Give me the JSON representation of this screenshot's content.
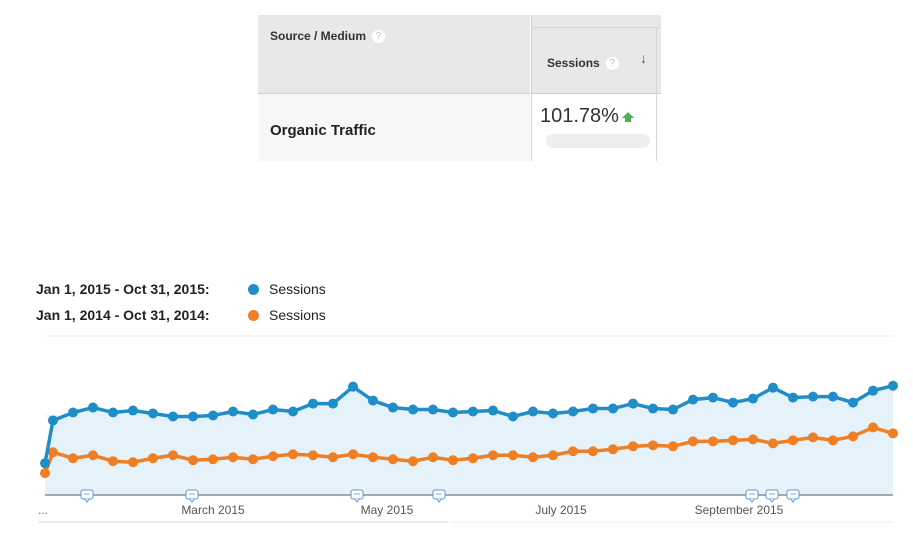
{
  "table": {
    "col1_header": "Source / Medium",
    "col2_header": "Sessions",
    "help_icon": "?",
    "sort_icon": "arrow-down-icon",
    "row_label": "Organic Traffic",
    "row_value": "101.78%",
    "trend_icon": "arrow-up-icon",
    "trend_color": "#4caf50"
  },
  "legend": [
    {
      "range": "Jan 1, 2015 - Oct 31, 2015:",
      "metric": "Sessions",
      "color": "#1f8dc8"
    },
    {
      "range": "Jan 1, 2014 - Oct 31, 2014:",
      "metric": "Sessions",
      "color": "#ef7f22"
    }
  ],
  "chart_data": {
    "type": "line",
    "grid": true,
    "ylim": [
      0,
      160
    ],
    "x_tick_labels": [
      "...",
      "March 2015",
      "May 2015",
      "July 2015",
      "September 2015"
    ],
    "annotation_icon": "comment-icon",
    "annotation_count": 7,
    "series": [
      {
        "color": "#1f8dc8",
        "values": [
          32,
          75,
          83,
          88,
          83,
          85,
          82,
          79,
          79,
          80,
          84,
          81,
          86,
          84,
          92,
          92,
          109,
          95,
          88,
          86,
          86,
          83,
          84,
          85,
          79,
          84,
          82,
          84,
          87,
          87,
          92,
          87,
          86,
          96,
          98,
          93,
          97,
          108,
          98,
          99,
          99,
          93,
          105,
          110
        ]
      },
      {
        "color": "#ef7f22",
        "values": [
          22,
          43,
          37,
          40,
          34,
          33,
          37,
          40,
          35,
          36,
          38,
          36,
          39,
          41,
          40,
          38,
          41,
          38,
          36,
          34,
          38,
          35,
          37,
          40,
          40,
          38,
          40,
          44,
          44,
          46,
          49,
          50,
          49,
          54,
          54,
          55,
          56,
          52,
          55,
          58,
          55,
          59,
          68,
          62
        ]
      }
    ]
  }
}
